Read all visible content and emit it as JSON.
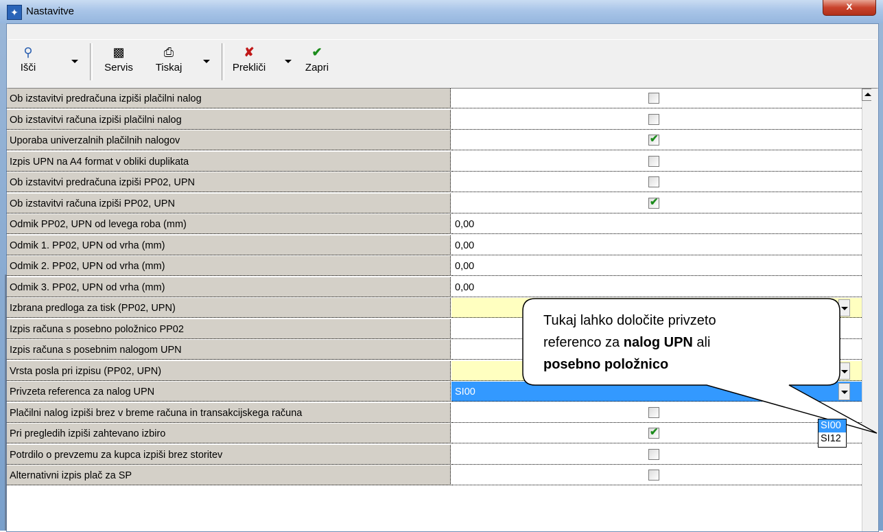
{
  "window": {
    "title": "Nastavitve",
    "close_label": "x"
  },
  "toolbar": {
    "find": "Išči",
    "service": "Servis",
    "print": "Tiskaj",
    "cancel": "Prekliči",
    "close": "Zapri"
  },
  "rows": [
    {
      "label": "Ob izstavitvi predračuna izpiši plačilni nalog",
      "type": "checkbox",
      "checked": false
    },
    {
      "label": "Ob izstavitvi računa izpiši plačilni nalog",
      "type": "checkbox",
      "checked": false
    },
    {
      "label": "Uporaba univerzalnih plačilnih nalogov",
      "type": "checkbox",
      "checked": true
    },
    {
      "label": "Izpis UPN na A4 format v obliki duplikata",
      "type": "checkbox",
      "checked": false
    },
    {
      "label": "Ob izstavitvi predračuna izpiši PP02, UPN",
      "type": "checkbox",
      "checked": false
    },
    {
      "label": "Ob izstavitvi računa izpiši PP02, UPN",
      "type": "checkbox",
      "checked": true
    },
    {
      "label": "Odmik PP02, UPN od levega roba (mm)",
      "type": "text",
      "value": "0,00"
    },
    {
      "label": "Odmik 1. PP02, UPN od vrha (mm)",
      "type": "text",
      "value": "0,00"
    },
    {
      "label": "Odmik 2. PP02, UPN od vrha (mm)",
      "type": "text",
      "value": "0,00"
    },
    {
      "label": "Odmik 3. PP02, UPN od vrha (mm)",
      "type": "text",
      "value": "0,00"
    },
    {
      "label": "Izbrana predloga za tisk (PP02, UPN)",
      "type": "dropdown",
      "value": "",
      "style": "yellow"
    },
    {
      "label": "Izpis računa s posebno položnico PP02",
      "type": "empty"
    },
    {
      "label": "Izpis računa s posebnim nalogom UPN",
      "type": "empty"
    },
    {
      "label": "Vrsta posla pri izpisu (PP02, UPN)",
      "type": "dropdown",
      "value": "",
      "style": "yellow"
    },
    {
      "label": "Privzeta referenca za nalog UPN",
      "type": "dropdown",
      "value": "SI00",
      "style": "selected"
    },
    {
      "label": "Plačilni nalog izpiši brez v breme računa in transakcijskega računa",
      "type": "checkbox",
      "checked": false
    },
    {
      "label": "Pri pregledih izpiši zahtevano izbiro",
      "type": "checkbox",
      "checked": true
    },
    {
      "label": "Potrdilo o prevzemu za kupca izpiši brez storitev",
      "type": "checkbox",
      "checked": false
    },
    {
      "label": "Alternativni izpis plač za SP",
      "type": "checkbox",
      "checked": false
    }
  ],
  "dropdown_options": [
    "SI00",
    "SI12"
  ],
  "callout": {
    "line1": "Tukaj lahko določite privzeto",
    "line2_pre": "referenco za ",
    "line2_bold": "nalog UPN",
    "line2_post": " ali",
    "line3_bold": "posebno položnico"
  },
  "colors": {
    "selected": "#3399ff",
    "yellow": "#ffffc0",
    "label_bg": "#d4d0c8",
    "check": "#1c8c1c"
  }
}
